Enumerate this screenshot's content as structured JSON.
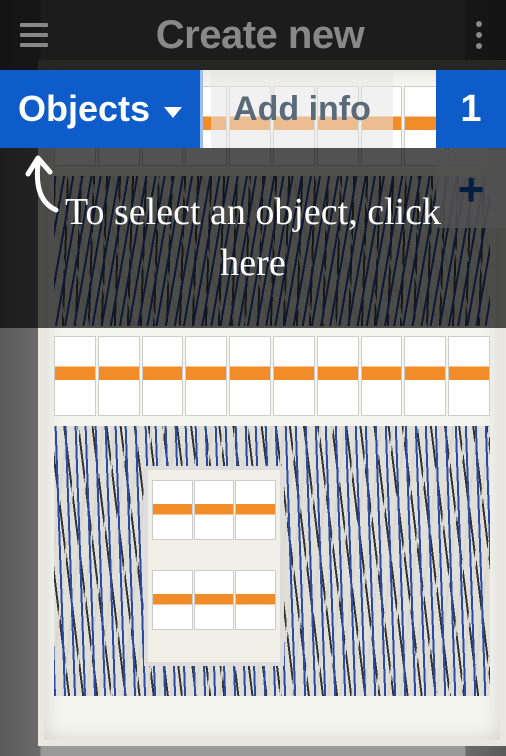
{
  "header": {
    "title": "Create new"
  },
  "toolbar": {
    "objects_label": "Objects",
    "addinfo_label": "Add info",
    "count": "1",
    "add_symbol": "+"
  },
  "tooltip": {
    "text": "To select an object, click here"
  }
}
